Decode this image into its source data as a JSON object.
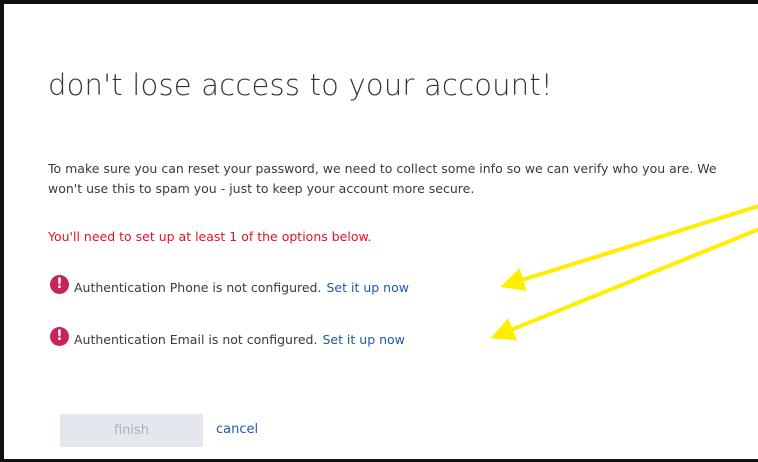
{
  "dialog": {
    "title": "don't lose access to your account!",
    "description": "To make sure you can reset your password, we need to collect some info so we can verify who you are. We won't use this to spam you - just to keep your account more secure.",
    "requirement": "You'll need to set up at least 1 of the options below."
  },
  "methods": [
    {
      "icon": "error-icon",
      "icon_glyph": "!",
      "status": "Authentication Phone is not configured.",
      "link_label": "Set it up now"
    },
    {
      "icon": "error-icon",
      "icon_glyph": "!",
      "status": "Authentication Email is not configured.",
      "link_label": "Set it up now"
    }
  ],
  "actions": {
    "finish_label": "finish",
    "finish_enabled": false,
    "cancel_label": "cancel"
  },
  "annotations": {
    "arrow_color": "#ffee00",
    "arrow_count": 2
  },
  "colors": {
    "title_text": "#333333",
    "warning_text": "#e81123",
    "error_icon": "#c7255a",
    "link": "#1e5aa8",
    "disabled_button": "#e4e8ee"
  }
}
